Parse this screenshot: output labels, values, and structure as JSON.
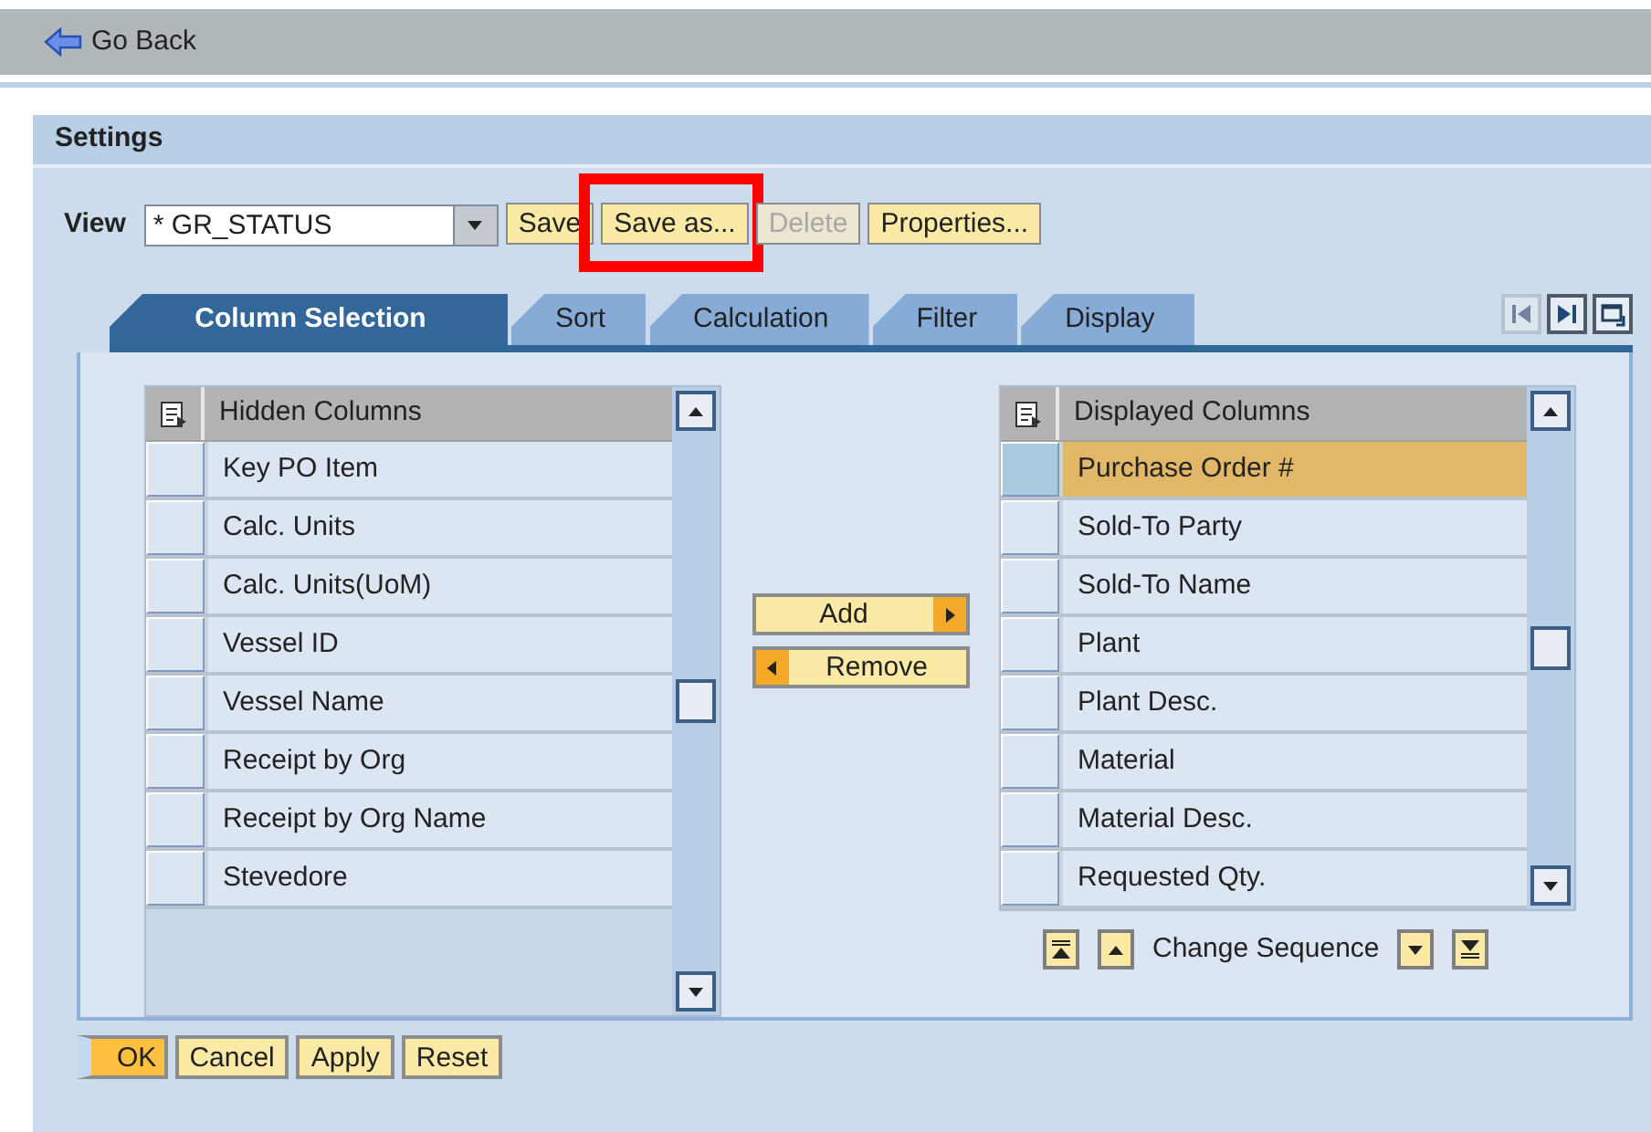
{
  "top_bar": {
    "back_label": "Go Back"
  },
  "settings": {
    "title": "Settings",
    "view": {
      "label": "View",
      "value": "* GR_STATUS"
    },
    "view_buttons": [
      {
        "label": "Save",
        "disabled": false,
        "highlighted": false
      },
      {
        "label": "Save as...",
        "disabled": false,
        "highlighted": true
      },
      {
        "label": "Delete",
        "disabled": true,
        "highlighted": false
      },
      {
        "label": "Properties...",
        "disabled": false,
        "highlighted": false
      }
    ],
    "tabs": [
      {
        "label": "Column Selection",
        "selected": true
      },
      {
        "label": "Sort",
        "selected": false
      },
      {
        "label": "Calculation",
        "selected": false
      },
      {
        "label": "Filter",
        "selected": false
      },
      {
        "label": "Display",
        "selected": false
      }
    ],
    "hidden_columns": {
      "header": "Hidden Columns",
      "rows": [
        {
          "label": "Key PO Item",
          "selected": false
        },
        {
          "label": "Calc. Units",
          "selected": false
        },
        {
          "label": "Calc. Units(UoM)",
          "selected": false
        },
        {
          "label": "Vessel ID",
          "selected": false
        },
        {
          "label": "Vessel Name",
          "selected": false
        },
        {
          "label": "Receipt by Org",
          "selected": false
        },
        {
          "label": "Receipt by Org Name",
          "selected": false
        },
        {
          "label": "Stevedore",
          "selected": false
        }
      ]
    },
    "move_buttons": [
      {
        "label": "Add",
        "kind": "right"
      },
      {
        "label": "Remove",
        "kind": "left"
      }
    ],
    "displayed_columns": {
      "header": "Displayed Columns",
      "rows": [
        {
          "label": "Purchase Order #",
          "selected": true
        },
        {
          "label": "Sold-To Party",
          "selected": false
        },
        {
          "label": "Sold-To Name",
          "selected": false
        },
        {
          "label": "Plant",
          "selected": false
        },
        {
          "label": "Plant Desc.",
          "selected": false
        },
        {
          "label": "Material",
          "selected": false
        },
        {
          "label": "Material Desc.",
          "selected": false
        },
        {
          "label": "Requested Qty.",
          "selected": false
        }
      ]
    },
    "sequence_label": "Change Sequence",
    "footer_buttons": [
      {
        "label": "OK",
        "kind": "default"
      },
      {
        "label": "Cancel",
        "kind": "normal"
      },
      {
        "label": "Apply",
        "kind": "normal"
      },
      {
        "label": "Reset",
        "kind": "normal"
      }
    ]
  }
}
